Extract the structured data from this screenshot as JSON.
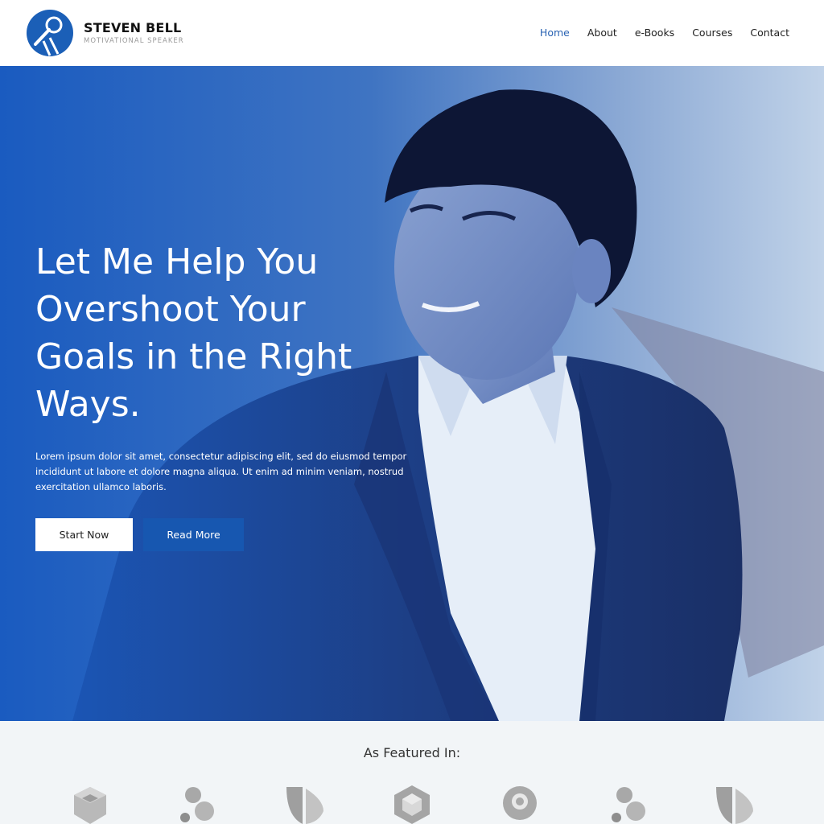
{
  "brand": {
    "name": "STEVEN BELL",
    "tagline": "MOTIVATIONAL SPEAKER",
    "logo_icon": "microphone-icon",
    "color": "#1b5fb7"
  },
  "nav": {
    "items": [
      {
        "label": "Home",
        "active": true
      },
      {
        "label": "About",
        "active": false
      },
      {
        "label": "e-Books",
        "active": false
      },
      {
        "label": "Courses",
        "active": false
      },
      {
        "label": "Contact",
        "active": false
      }
    ],
    "active_color": "#2a63b3"
  },
  "hero": {
    "title": "Let Me Help You Overshoot Your Goals in the Right Ways.",
    "text": "Lorem ipsum dolor sit amet, consectetur adipiscing elit, sed do eiusmod tempor incididunt ut labore et dolore magna aliqua. Ut enim ad minim veniam, nostrud exercitation ullamco laboris.",
    "primary_button": "Start Now",
    "secondary_button": "Read More",
    "accent_color": "#1757b0"
  },
  "featured": {
    "title": "As Featured In:",
    "logos": [
      "cube-logo-icon",
      "molecule-logo-icon",
      "leaf-play-logo-icon",
      "hexagon-cube-logo-icon",
      "pin-logo-icon",
      "molecule-logo-icon",
      "leaf-play-logo-icon"
    ]
  }
}
